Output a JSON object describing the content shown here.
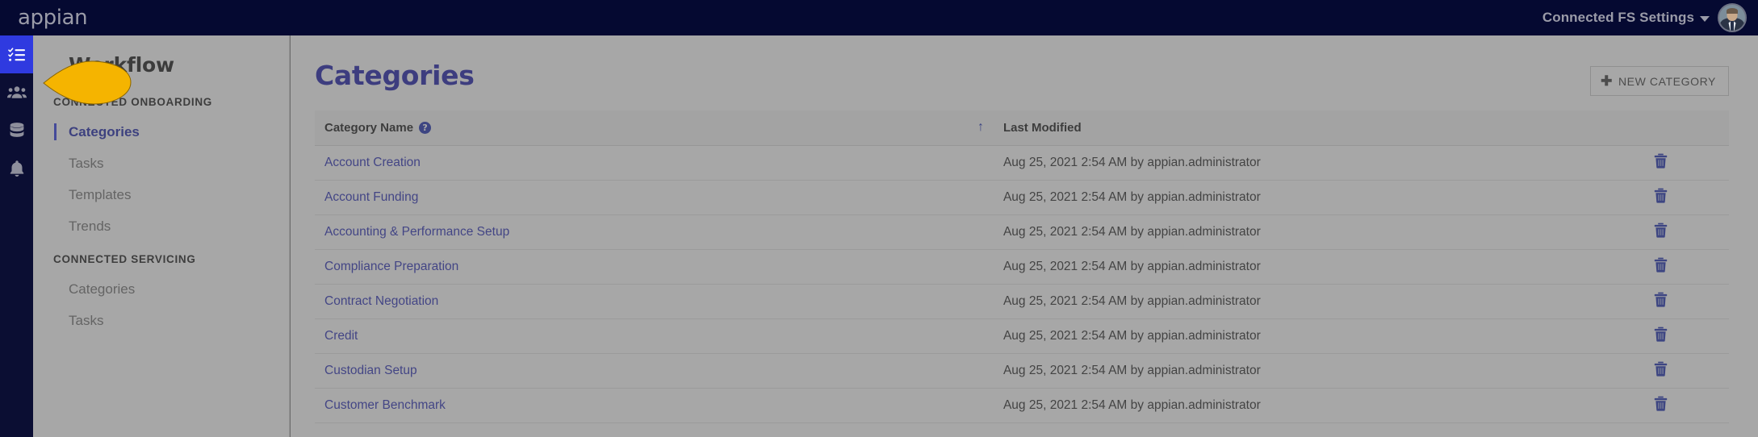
{
  "topbar": {
    "logo": "appian",
    "settings_label": "Connected FS Settings",
    "caret_icon": "chevron-down-icon",
    "avatar_icon": "user-avatar"
  },
  "rail": {
    "items": [
      {
        "icon": "task-list-icon",
        "active": true
      },
      {
        "icon": "users-icon",
        "active": false
      },
      {
        "icon": "database-icon",
        "active": false
      },
      {
        "icon": "bell-icon",
        "active": false
      }
    ]
  },
  "sidebar": {
    "title": "Workflow",
    "sections": [
      {
        "label": "CONNECTED ONBOARDING",
        "items": [
          {
            "label": "Categories",
            "active": true
          },
          {
            "label": "Tasks",
            "active": false
          },
          {
            "label": "Templates",
            "active": false
          },
          {
            "label": "Trends",
            "active": false
          }
        ]
      },
      {
        "label": "CONNECTED SERVICING",
        "items": [
          {
            "label": "Categories",
            "active": false
          },
          {
            "label": "Tasks",
            "active": false
          }
        ]
      }
    ]
  },
  "main": {
    "page_title": "Categories",
    "new_button_label": "NEW CATEGORY",
    "new_button_icon": "plus-icon",
    "table": {
      "columns": [
        {
          "label": "Category Name",
          "help_icon": "help-circle-icon",
          "sort": "ascending",
          "sort_icon": "arrow-up-icon"
        },
        {
          "label": "Last Modified"
        },
        {
          "label": ""
        }
      ],
      "rows": [
        {
          "name": "Account Creation",
          "modified": "Aug 25, 2021 2:54 AM by appian.administrator",
          "delete_icon": "trash-icon"
        },
        {
          "name": "Account Funding",
          "modified": "Aug 25, 2021 2:54 AM by appian.administrator",
          "delete_icon": "trash-icon"
        },
        {
          "name": "Accounting & Performance Setup",
          "modified": "Aug 25, 2021 2:54 AM by appian.administrator",
          "delete_icon": "trash-icon"
        },
        {
          "name": "Compliance Preparation",
          "modified": "Aug 25, 2021 2:54 AM by appian.administrator",
          "delete_icon": "trash-icon"
        },
        {
          "name": "Contract Negotiation",
          "modified": "Aug 25, 2021 2:54 AM by appian.administrator",
          "delete_icon": "trash-icon"
        },
        {
          "name": "Credit",
          "modified": "Aug 25, 2021 2:54 AM by appian.administrator",
          "delete_icon": "trash-icon"
        },
        {
          "name": "Custodian Setup",
          "modified": "Aug 25, 2021 2:54 AM by appian.administrator",
          "delete_icon": "trash-icon"
        },
        {
          "name": "Customer Benchmark",
          "modified": "Aug 25, 2021 2:54 AM by appian.administrator",
          "delete_icon": "trash-icon"
        }
      ]
    }
  },
  "cursor": {
    "icon": "pointer-cursor",
    "color": "#F5B400"
  },
  "colors": {
    "topbar_bg": "#050931",
    "rail_bg": "#0B0E33",
    "accent_blue": "#2F3AE0",
    "link_blue": "#2A2FB4",
    "title_blue": "#1E1EA8",
    "scrim": "rgba(90,90,90,0.52)"
  }
}
